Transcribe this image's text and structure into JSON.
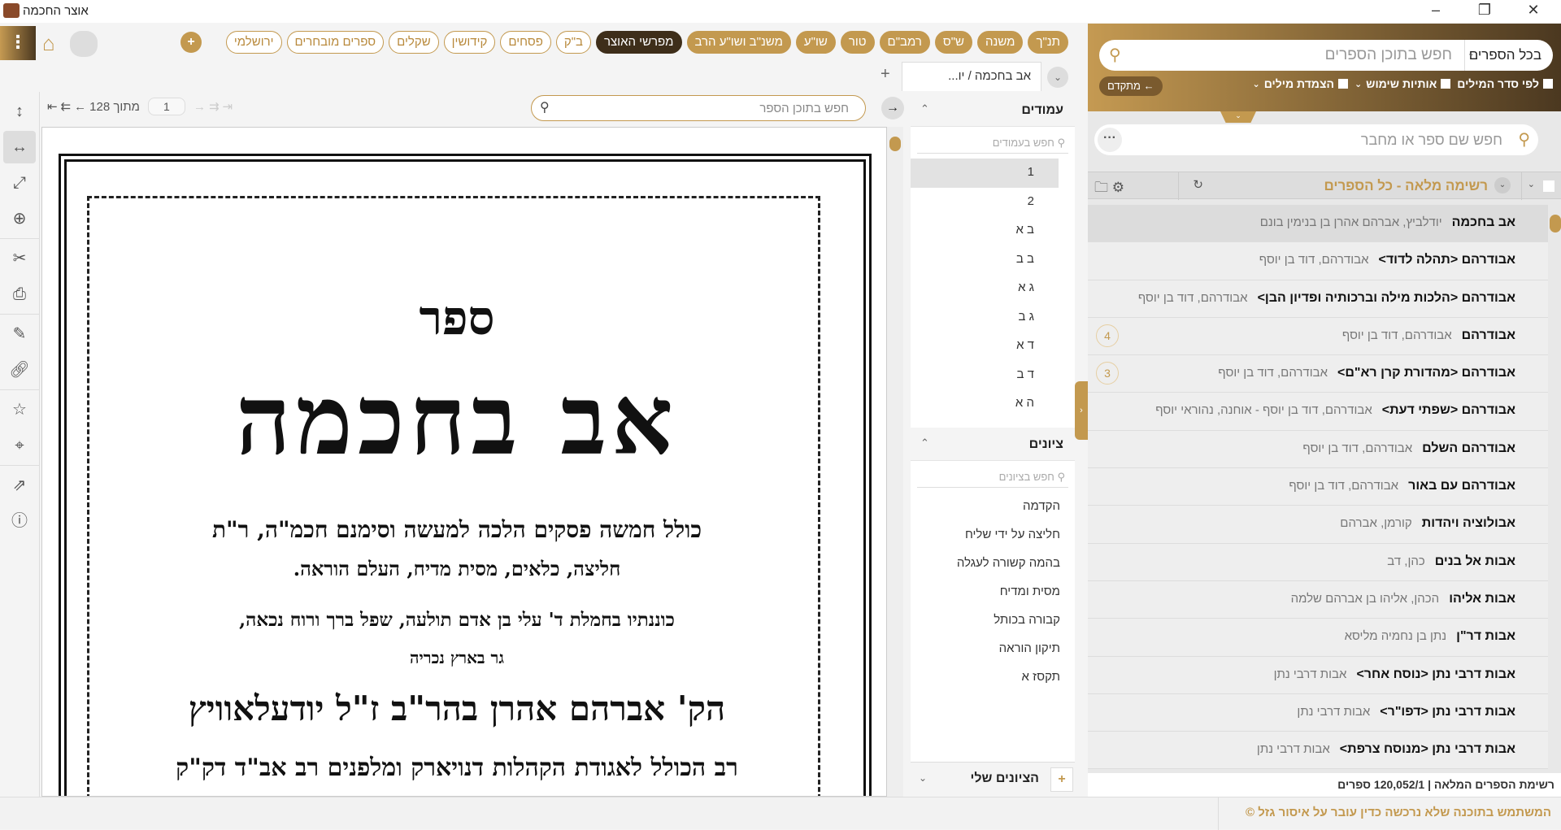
{
  "window": {
    "title": "אוצר החכמה",
    "minimize": "–",
    "restore": "❐",
    "close": "✕"
  },
  "toolbar": {
    "menu": "⋮",
    "home": "⌂",
    "add": "+",
    "categories": [
      {
        "label": "תנ\"ך",
        "style": "fill"
      },
      {
        "label": "משנה",
        "style": "fill"
      },
      {
        "label": "ש\"ס",
        "style": "fill"
      },
      {
        "label": "רמב\"ם",
        "style": "fill"
      },
      {
        "label": "טור",
        "style": "fill"
      },
      {
        "label": "שו\"ע",
        "style": "fill"
      },
      {
        "label": "משנ\"ב ושו\"ע הרב",
        "style": "fill"
      },
      {
        "label": "מפרשי האוצר",
        "style": "dark"
      },
      {
        "label": "ב\"ק",
        "style": "out"
      },
      {
        "label": "פסחים",
        "style": "out"
      },
      {
        "label": "קידושין",
        "style": "out"
      },
      {
        "label": "שקלים",
        "style": "out"
      },
      {
        "label": "ספרים מובחרים",
        "style": "out"
      },
      {
        "label": "ירושלמי",
        "style": "out"
      }
    ]
  },
  "tabs": {
    "active": "אב בחכמה / יו...",
    "add": "+",
    "dropdown": "⌄"
  },
  "doc": {
    "page_current": "1",
    "page_total_label": "מתוך 128",
    "search_placeholder": "חפש בתוכן הספר",
    "nav_first": "⇤",
    "nav_prev_many": "⇇",
    "nav_prev": "←",
    "nav_next": "→",
    "nav_next_many": "⇉",
    "nav_last": "⇥",
    "collapse": "→",
    "scan": {
      "line1": "ספר",
      "title": "אב בחכמה",
      "line3": "כולל חמשה פסקים הלכה למעשה וסימנם חכמ\"ה, ר\"ת",
      "line4": "חליצה, כלאים, מסית מדיח, העלם הוראה.",
      "line5": "כוננתיו בחמלת ד' עלי בן אדם תולעה, שפל ברך ורוח נכאה,",
      "line6": "גר בארץ נכריה",
      "line7": "הק' אברהם אהרן בהר\"ב ז\"ל יודעלאוויץ",
      "line8": "רב הכולל לאגודת הקהלות דנויארק ומלפנים רב אב\"ד דק\"ק"
    }
  },
  "tools": [
    "vertical-fit",
    "horizontal-fit",
    "fullscreen",
    "zoom-in",
    "crop",
    "print",
    "annotate",
    "link",
    "favorite",
    "location",
    "open-external",
    "book-info"
  ],
  "pages_panel": {
    "title": "עמודים",
    "search_placeholder": "חפש בעמודים",
    "items": [
      "1",
      "2",
      "ב א",
      "ב ב",
      "ג א",
      "ג ב",
      "ד א",
      "ד ב",
      "ה א"
    ]
  },
  "bookmarks_panel": {
    "title": "ציונים",
    "search_placeholder": "חפש בציונים",
    "items": [
      "הקדמה",
      "חליצה על ידי שליח",
      "בהמה קשורה לעגלה",
      "מסית ומדיח",
      "קבורה בכותל",
      "תיקון הוראה",
      "תקסז א"
    ]
  },
  "my_bookmarks": {
    "title": "הציונים שלי",
    "add": "+"
  },
  "right": {
    "scope": "בכל הספרים",
    "search_placeholder": "חפש בתוכן הספרים",
    "options": [
      "הצמדת מילים",
      "אותיות שימוש",
      "לפי סדר המילים"
    ],
    "advanced": "מתקדם ←",
    "book_search_placeholder": "חפש שם ספר או מחבר",
    "more": "···",
    "list_title": "רשימה מלאה - כל הספרים",
    "rows": [
      {
        "title": "אב בחכמה",
        "author": "יודלביץ, אברהם אהרן בן בנימין בונם",
        "selected": true
      },
      {
        "title": "אבודרהם <תהלה לדוד>",
        "author": "אבודרהם, דוד בן יוסף"
      },
      {
        "title": "אבודרהם <הלכות מילה וברכותיה ופדיון הבן>",
        "author": "אבודרהם, דוד בן יוסף"
      },
      {
        "title": "אבודרהם",
        "author": "אבודרהם, דוד בן יוסף",
        "badge": "4"
      },
      {
        "title": "אבודרהם <מהדורת קרן רא\"ם>",
        "author": "אבודרהם, דוד בן יוסף",
        "badge": "3"
      },
      {
        "title": "אבודרהם <שפתי דעת>",
        "author": "אבודרהם, דוד בן יוסף - אוחנה, נהוראי יוסף"
      },
      {
        "title": "אבודרהם השלם",
        "author": "אבודרהם, דוד בן יוסף"
      },
      {
        "title": "אבודרהם עם באור",
        "author": "אבודרהם, דוד בן יוסף"
      },
      {
        "title": "אבולוציה ויהדות",
        "author": "קורמן, אברהם"
      },
      {
        "title": "אבות אל בנים",
        "author": "כהן, דב"
      },
      {
        "title": "אבות אליהו",
        "author": "הכהן, אליהו בן אברהם שלמה"
      },
      {
        "title": "אבות דר\"ן",
        "author": "נתן בן נחמיה מליסא"
      },
      {
        "title": "אבות דרבי נתן <נוסח אחר>",
        "author": "אבות דרבי נתן"
      },
      {
        "title": "אבות דרבי נתן <דפו\"ר>",
        "author": "אבות דרבי נתן"
      },
      {
        "title": "אבות דרבי נתן <מנוסח צרפת>",
        "author": "אבות דרבי נתן"
      }
    ],
    "footer": "רשימת הספרים המלאה | 120,052/1 ספרים"
  },
  "status": {
    "message": "המשתמש בתוכנה שלא נרכשה כדין עובר על איסור גזל ©"
  },
  "colors": {
    "accent": "#c3994f",
    "dark": "#3e2e1a"
  }
}
